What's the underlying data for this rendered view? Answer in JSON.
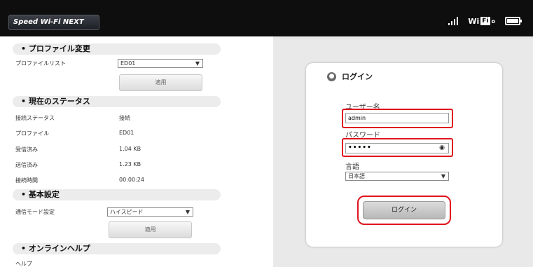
{
  "header": {
    "brand": "Speed Wi-Fi NEXT",
    "wifi_label": "Wi",
    "wifi_box": "Fi",
    "wifi_dot": "o"
  },
  "profile": {
    "section": "• プロファイル変更",
    "list_label": "プロファイルリスト",
    "selected": "ED01",
    "apply": "適用"
  },
  "status": {
    "section": "• 現在のステータス",
    "rows": [
      {
        "label": "接続ステータス",
        "value": "接続"
      },
      {
        "label": "プロファイル",
        "value": "ED01"
      },
      {
        "label": "受信済み",
        "value": "1.04 KB"
      },
      {
        "label": "送信済み",
        "value": "1.23 KB"
      },
      {
        "label": "接続時間",
        "value": "00:00:24"
      }
    ]
  },
  "basic": {
    "section": "• 基本設定",
    "mode_label": "通信モード設定",
    "mode_selected": "ハイスピード",
    "apply": "適用"
  },
  "help": {
    "section": "• オンラインヘルプ",
    "item": "ヘルプ"
  },
  "login": {
    "title": "ログイン",
    "username_label": "ユーザー名",
    "username_value": "admin",
    "password_label": "パスワード",
    "password_mask": "•••••",
    "language_label": "言語",
    "language_selected": "日本語",
    "button": "ログイン"
  },
  "colors": {
    "highlight": "#e0141e",
    "header_bg": "#0e0e0e",
    "right_bg": "#e9e9e9"
  },
  "icons": [
    "signal-icon",
    "wifi-icon",
    "battery-icon",
    "user-icon",
    "eye-icon",
    "chevron-down-icon"
  ]
}
